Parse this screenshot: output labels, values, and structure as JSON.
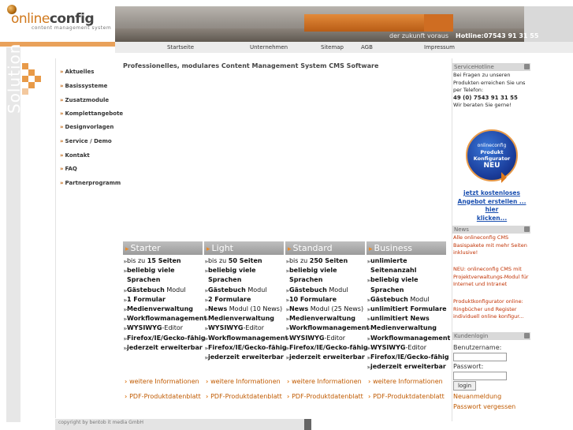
{
  "logo": {
    "word_a": "online",
    "word_b": "config",
    "sub": "content management system"
  },
  "header": {
    "slogan": "der zukunft voraus",
    "hotline": "Hotline:07543 91 31 55"
  },
  "topnav": [
    "Startseite",
    "Unternehmen",
    "Sitemap",
    "AGB",
    "Impressum"
  ],
  "side_label": "Solution",
  "nav": [
    "Aktuelles",
    "Basissysteme",
    "Zusatzmodule",
    "Komplettangebote",
    "Designvorlagen",
    "Service / Demo",
    "Kontakt",
    "FAQ",
    "Partnerprogramm"
  ],
  "main": {
    "heading": "Professionelles, modulares Content Management System CMS Software"
  },
  "products": [
    {
      "name": "Starter",
      "features": [
        [
          [
            "bis zu ",
            ""
          ],
          [
            "15 Seiten",
            "b"
          ]
        ],
        [
          [
            "beliebig viele",
            "b"
          ]
        ],
        [
          [
            "Sprachen",
            "b",
            "ind"
          ]
        ],
        [
          [
            "Gästebuch",
            "b"
          ],
          [
            " Modul",
            ""
          ]
        ],
        [
          [
            "1 Formular",
            "b"
          ]
        ],
        [
          [
            "Medienverwaltung",
            "b"
          ]
        ],
        [
          [
            "Workflowmanagement",
            "b"
          ]
        ],
        [
          [
            "WYSIWYG",
            "b"
          ],
          [
            "-Editor",
            ""
          ]
        ],
        [
          [
            "Firefox/IE/Gecko-fähig",
            "b"
          ]
        ],
        [
          [
            "jederzeit erweiterbar",
            "b"
          ]
        ]
      ],
      "more": "weitere Informationen",
      "pdf": "PDF-Produktdatenblatt"
    },
    {
      "name": "Light",
      "features": [
        [
          [
            "bis zu ",
            ""
          ],
          [
            "50 Seiten",
            "b"
          ]
        ],
        [
          [
            "beliebig viele",
            "b"
          ]
        ],
        [
          [
            "Sprachen",
            "b",
            "ind"
          ]
        ],
        [
          [
            "Gästebuch",
            "b"
          ],
          [
            " Modul",
            ""
          ]
        ],
        [
          [
            "2 Formulare",
            "b"
          ]
        ],
        [
          [
            "News",
            "b"
          ],
          [
            " Modul (10 News)",
            ""
          ]
        ],
        [
          [
            "Medienverwaltung",
            "b"
          ]
        ],
        [
          [
            "WYSIWYG",
            "b"
          ],
          [
            "-Editor",
            ""
          ]
        ],
        [
          [
            "Workflowmanagement",
            "b"
          ]
        ],
        [
          [
            "Firefox/IE/Gecko-fähig",
            "b"
          ]
        ],
        [
          [
            "jederzeit erweiterbar",
            "b"
          ]
        ]
      ],
      "more": "weitere Informationen",
      "pdf": "PDF-Produktdatenblatt"
    },
    {
      "name": "Standard",
      "features": [
        [
          [
            "bis zu ",
            ""
          ],
          [
            "250 Seiten",
            "b"
          ]
        ],
        [
          [
            "beliebig viele",
            "b"
          ]
        ],
        [
          [
            "Sprachen",
            "b",
            "ind"
          ]
        ],
        [
          [
            "Gästebuch",
            "b"
          ],
          [
            " Modul",
            ""
          ]
        ],
        [
          [
            "10 Formulare",
            "b"
          ]
        ],
        [
          [
            "News",
            "b"
          ],
          [
            " Modul (25 News)",
            ""
          ]
        ],
        [
          [
            "Medienverwaltung",
            "b"
          ]
        ],
        [
          [
            "Workflowmanagement",
            "b"
          ]
        ],
        [
          [
            "WYSIWYG",
            "b"
          ],
          [
            "-Editor",
            ""
          ]
        ],
        [
          [
            "Firefox/IE/Gecko-fähig",
            "b"
          ]
        ],
        [
          [
            "jederzeit erweiterbar",
            "b"
          ]
        ]
      ],
      "more": "weitere Informationen",
      "pdf": "PDF-Produktdatenblatt"
    },
    {
      "name": "Business",
      "features": [
        [
          [
            "unlimierte",
            "b"
          ]
        ],
        [
          [
            "Seitenanzahl",
            "b",
            "ind"
          ]
        ],
        [
          [
            "beliebig viele",
            "b"
          ]
        ],
        [
          [
            "Sprachen",
            "b",
            "ind"
          ]
        ],
        [
          [
            "Gästebuch",
            "b"
          ],
          [
            " Modul",
            ""
          ]
        ],
        [
          [
            "unlimitiert Formulare",
            "b"
          ]
        ],
        [
          [
            "unlimitiert News",
            "b"
          ]
        ],
        [
          [
            "Medienverwaltung",
            "b"
          ]
        ],
        [
          [
            "Workflowmanagement",
            "b"
          ]
        ],
        [
          [
            "WYSIWYG",
            "b"
          ],
          [
            "-Editor",
            ""
          ]
        ],
        [
          [
            "Firefox/IE/Gecko-fähig",
            "b"
          ]
        ],
        [
          [
            "jederzeit erweiterbar",
            "b"
          ]
        ]
      ],
      "more": "weitere Informationen",
      "pdf": "PDF-Produktdatenblatt"
    }
  ],
  "sidebar": {
    "hotline_title": "ServiceHotline",
    "hotline_text": [
      "Bei Fragen zu unseren",
      "Produkten erreichen Sie uns",
      "per Telefon:"
    ],
    "hotline_number": "49 (0) 7543 91 31 55",
    "hotline_note": "Wir beraten Sie gerne!",
    "badge": {
      "t1": "onlineconfig",
      "t2": "Produkt Konfigurator",
      "t3": "NEU"
    },
    "offer_link": [
      "jetzt kostenloses",
      "Angebot erstellen ... hier",
      "klicken..."
    ],
    "news_title": "News",
    "news": [
      [
        "Alle onlineconfig CMS",
        "Basispakete mit mehr Seiten",
        "inklusive!"
      ],
      [
        "NEU: onlineconfig CMS mit",
        "Projektverwaltungs-Modul für",
        "Internet und Intranet"
      ],
      [
        "Produktkonfigurator online:",
        "Ringbücher und Register",
        "individuell online konfigur..."
      ]
    ],
    "login_title": "Kundenlogin",
    "user_label": "Benutzername:",
    "pass_label": "Passwort:",
    "login_button": "login",
    "register": "Neuanmeldung",
    "forgot": "Passwort vergessen"
  },
  "footer": {
    "copyright": "copyright by bentob it media GmbH",
    "line2": ""
  },
  "colors": {
    "accent": "#e89a48",
    "link": "#c05a00",
    "blue": "#1a4fb0"
  }
}
